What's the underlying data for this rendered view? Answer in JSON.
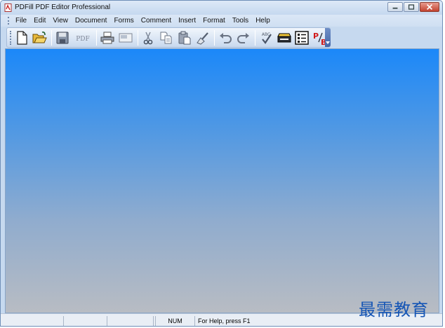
{
  "window": {
    "title": "PDFill PDF Editor Professional",
    "controls": [
      "minimize-icon",
      "maximize-icon",
      "close-icon"
    ]
  },
  "menubar": {
    "items": [
      "File",
      "Edit",
      "View",
      "Document",
      "Forms",
      "Comment",
      "Insert",
      "Format",
      "Tools",
      "Help"
    ]
  },
  "toolbar": {
    "buttons": [
      {
        "icon": "new-document-icon"
      },
      {
        "icon": "open-folder-icon"
      },
      {
        "icon": "save-icon"
      },
      {
        "icon": "save-as-pdf-icon",
        "label": "PDF"
      },
      {
        "icon": "print-icon"
      },
      {
        "icon": "scan-image-icon"
      },
      {
        "icon": "cut-icon"
      },
      {
        "icon": "copy-icon"
      },
      {
        "icon": "paste-icon"
      },
      {
        "icon": "clear-icon"
      },
      {
        "icon": "undo-icon"
      },
      {
        "icon": "redo-icon"
      },
      {
        "icon": "spell-check-icon",
        "label": "ABC"
      },
      {
        "icon": "scanner-icon"
      },
      {
        "icon": "form-list-icon"
      },
      {
        "icon": "pb-icon",
        "label": "P/B"
      }
    ]
  },
  "statusbar": {
    "panes": [
      "",
      "",
      "",
      "",
      "NUM",
      "For Help, press F1"
    ]
  },
  "watermark": "最需教育",
  "colors": {
    "workspace_top": "#1b88f9",
    "workspace_bottom": "#b8bcc3",
    "chrome": "#c6d9ef",
    "watermark": "#1555b5"
  }
}
